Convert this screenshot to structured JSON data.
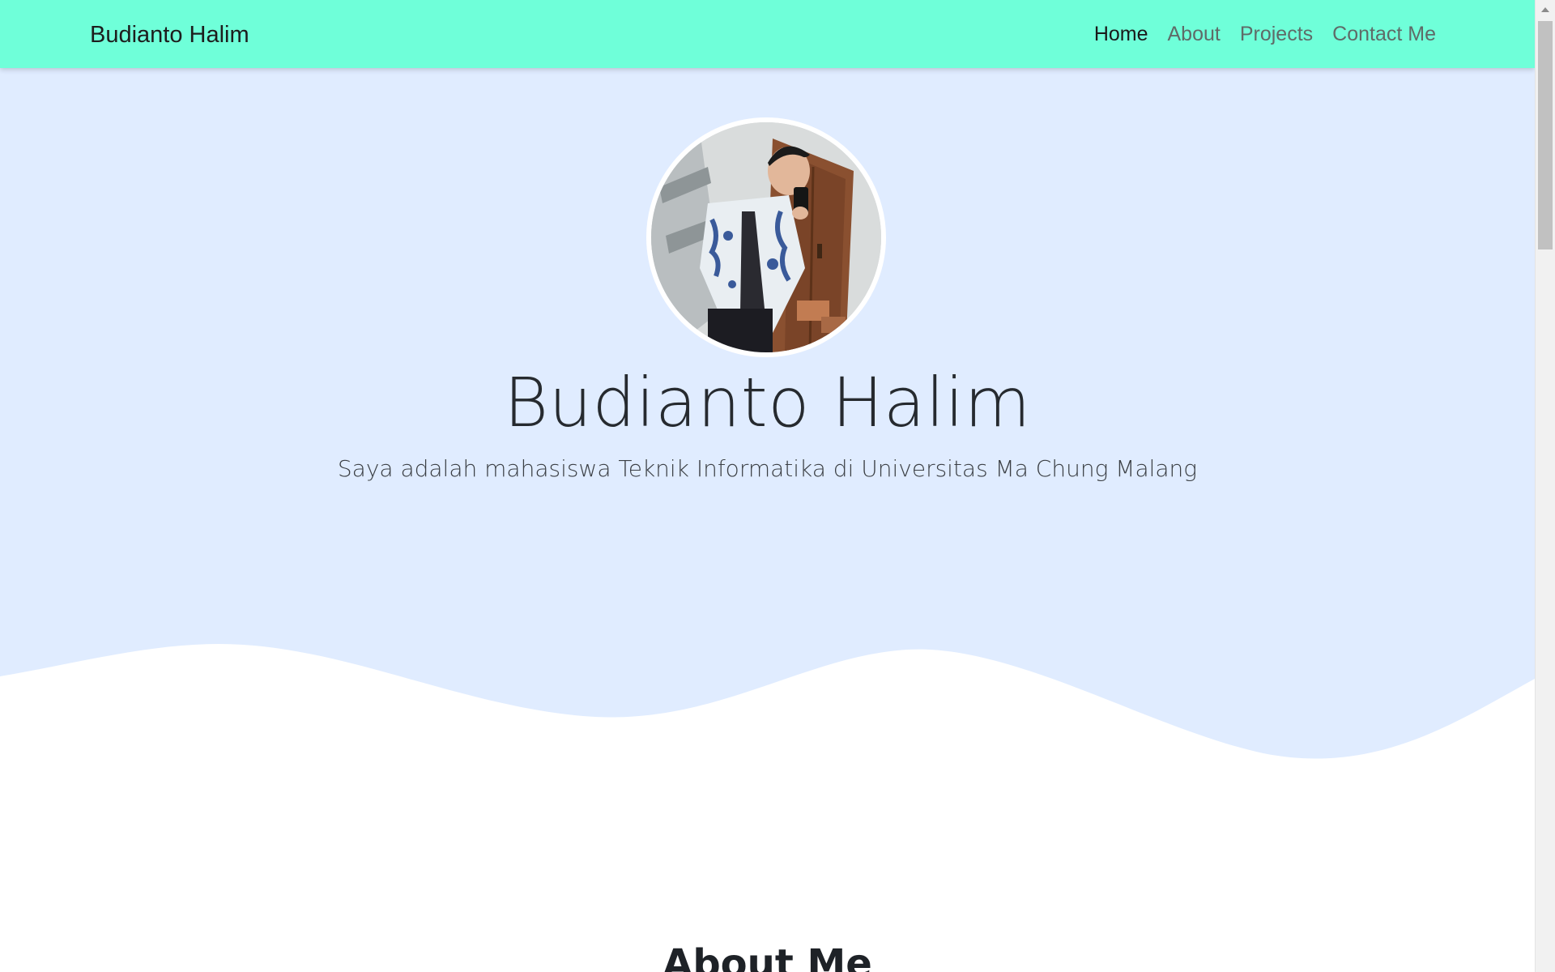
{
  "navbar": {
    "brand": "Budianto Halim",
    "links": [
      {
        "label": "Home",
        "active": true
      },
      {
        "label": "About",
        "active": false
      },
      {
        "label": "Projects",
        "active": false
      },
      {
        "label": "Contact Me",
        "active": false
      }
    ]
  },
  "hero": {
    "name": "Budianto Halim",
    "tagline": "Saya adalah mahasiswa Teknik Informatika di Universitas Ma Chung Malang",
    "avatar_icon": "profile-photo"
  },
  "about": {
    "title": "About Me"
  },
  "colors": {
    "navbar_bg": "#6fffd9",
    "hero_bg": "#e0ecff",
    "page_bg": "#ffffff"
  }
}
